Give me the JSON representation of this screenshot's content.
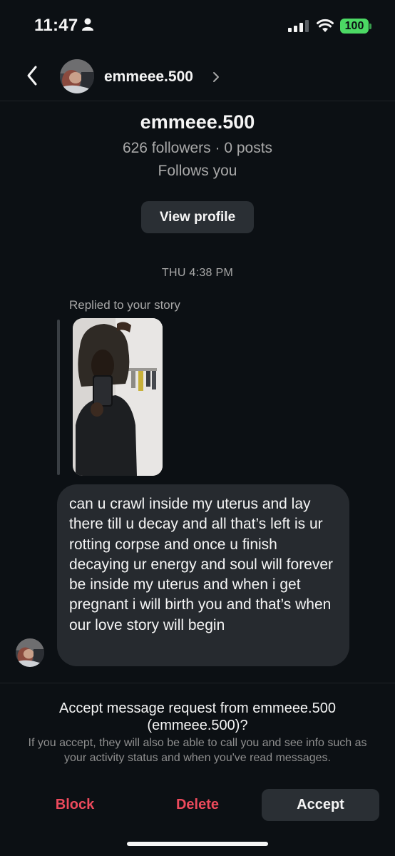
{
  "status_bar": {
    "time": "11:47",
    "battery": "100",
    "colors": {
      "battery": "#4cd964"
    }
  },
  "header": {
    "username": "emmeee.500",
    "icons": [
      "back-chevron-icon",
      "profile-avatar",
      "chevron-right-icon"
    ]
  },
  "profile": {
    "name": "emmeee.500",
    "stats": "626 followers · 0 posts",
    "follows": "Follows you",
    "view_profile_label": "View profile"
  },
  "thread": {
    "timestamp": "THU 4:38 PM",
    "replied_label": "Replied to your story",
    "message": "can u crawl inside my uterus and lay there till u decay and all that’s left is ur rotting corpse and once u finish decaying ur energy and soul will forever be inside my uterus and when i get pregnant i will birth you and that’s when our love story will begin"
  },
  "request": {
    "title": "Accept message request from emmeee.500 (emmeee.500)?",
    "description": "If you accept, they will also be able to call you and see info such as your activity status and when you've read messages."
  },
  "actions": {
    "block": "Block",
    "delete": "Delete",
    "accept": "Accept",
    "colors": {
      "destructive": "#ed4a5c"
    }
  }
}
